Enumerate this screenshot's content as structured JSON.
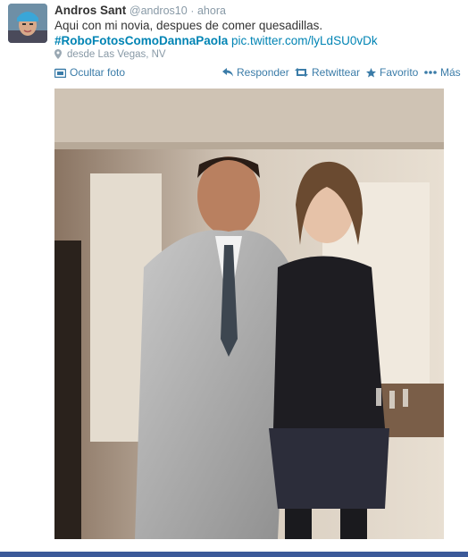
{
  "tweet": {
    "author_name": "Andros Sant",
    "author_handle": "@andros10",
    "separator": "·",
    "time": "ahora",
    "text_line1": "Aqui con mi novia, despues de comer quesadillas.",
    "hashtag": "#RoboFotosComoDannaPaola",
    "link": "pic.twitter.com/lyLdSU0vDk",
    "location": "desde Las Vegas, NV",
    "avatar_icon": "user-avatar",
    "pin_icon": "location-pin-icon"
  },
  "actions": {
    "hide_photo": "Ocultar foto",
    "reply": "Responder",
    "retweet": "Retwittear",
    "favorite": "Favorito",
    "more": "Más"
  },
  "colors": {
    "link": "#0084b4",
    "hashtag": "#2b7bb9",
    "muted": "#8899a6",
    "action": "#3b7ca8",
    "bottom_bar": "#3c5a99"
  }
}
